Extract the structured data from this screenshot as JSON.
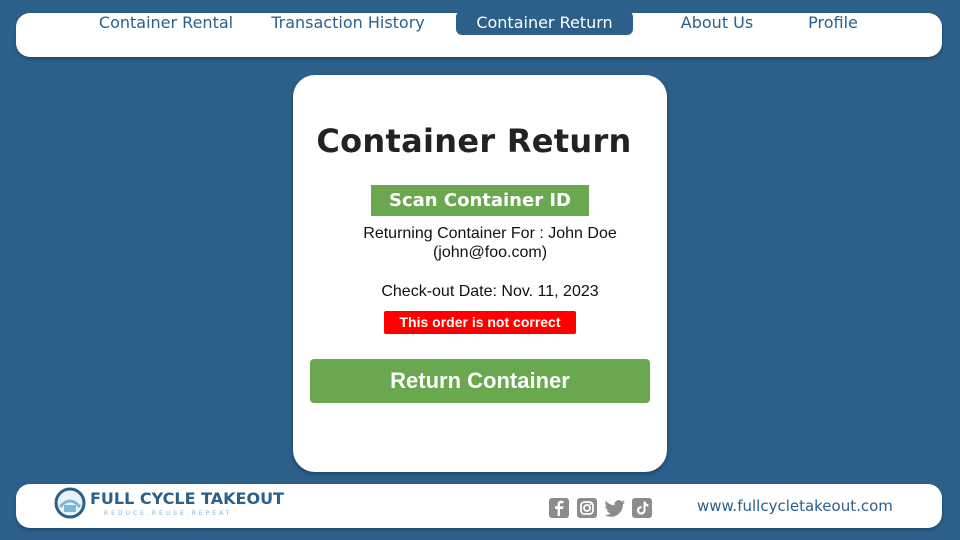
{
  "nav": {
    "items": [
      {
        "label": "Container Rental",
        "active": false
      },
      {
        "label": "Transaction History",
        "active": false
      },
      {
        "label": "Container Return",
        "active": true
      },
      {
        "label": "About Us",
        "active": false
      },
      {
        "label": "Profile",
        "active": false
      }
    ]
  },
  "card": {
    "title": "Container Return",
    "scan_button": "Scan Container ID",
    "returning_for": "Returning Container For : John Doe",
    "email": "(john@foo.com)",
    "checkout_date": "Check-out Date: Nov. 11, 2023",
    "error_message": "This order is not correct",
    "return_button": "Return Container"
  },
  "footer": {
    "logo_title": "FULL CYCLE TAKEOUT",
    "logo_tagline": "REDUCE.REUSE.REPEAT",
    "social_icons": [
      "facebook-icon",
      "instagram-icon",
      "twitter-icon",
      "tiktok-icon"
    ],
    "website": "www.fullcycletakeout.com"
  },
  "colors": {
    "background": "#2c5f8a",
    "accent_green": "#69a84f",
    "error_red": "#ff0000",
    "surface": "#ffffff"
  }
}
